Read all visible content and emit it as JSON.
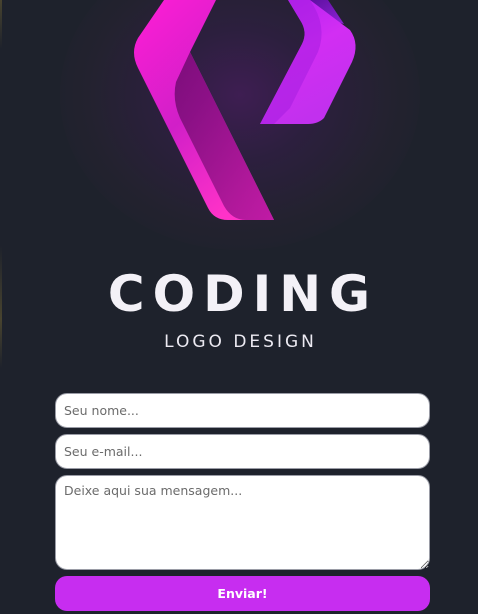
{
  "brand": {
    "title": "CODING",
    "subtitle": "LOGO DESIGN",
    "logo_icon": "logo-mark-icon",
    "colors": {
      "magenta": "#ff2bd6",
      "purple": "#c22ff0",
      "background": "#1e222c"
    }
  },
  "form": {
    "name_placeholder": "Seu nome...",
    "email_placeholder": "Seu e-mail...",
    "message_placeholder": "Deixe aqui sua mensagem...",
    "submit_label": "Enviar!",
    "submit_color": "#c72df0"
  }
}
